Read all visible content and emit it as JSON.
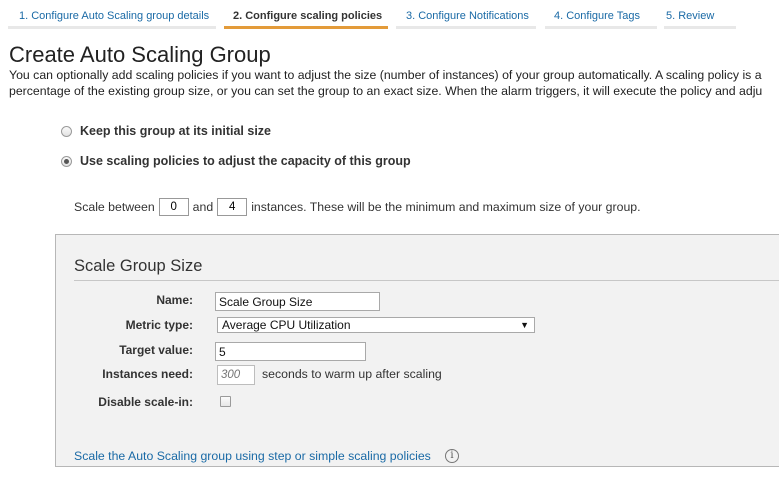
{
  "wizard": {
    "steps": [
      {
        "label": "1. Configure Auto Scaling group details"
      },
      {
        "label": "2. Configure scaling policies",
        "active": true
      },
      {
        "label": "3. Configure Notifications"
      },
      {
        "label": "4. Configure Tags"
      },
      {
        "label": "5. Review"
      }
    ],
    "active_color": "#e39b3a",
    "link_color": "#1a6aa6"
  },
  "page": {
    "title": "Create Auto Scaling Group",
    "intro_line1": "You can optionally add scaling policies if you want to adjust the size (number of instances) of your group automatically. A scaling policy is a",
    "intro_line2": "percentage of the existing group size, or you can set the group to an exact size. When the alarm triggers, it will execute the policy and adju"
  },
  "options": {
    "keep_size_label": "Keep this group at its initial size",
    "use_policies_label": "Use scaling policies to adjust the capacity of this group",
    "selected": "use_policies"
  },
  "scale_range": {
    "prefix": "Scale between",
    "min": "0",
    "and": "and",
    "max": "4",
    "suffix": "instances. These will be the minimum and maximum size of your group."
  },
  "policy": {
    "section_title": "Scale Group Size",
    "name_label": "Name:",
    "name_value": "Scale Group Size",
    "metric_label": "Metric type:",
    "metric_value": "Average CPU Utilization",
    "target_label": "Target value:",
    "target_value": "5",
    "warmup_label": "Instances need:",
    "warmup_placeholder": "300",
    "warmup_suffix": "seconds to warm up after scaling",
    "disable_label": "Disable scale-in:",
    "disable_checked": false,
    "step_link": "Scale the Auto Scaling group using step or simple scaling policies",
    "info_icon": "info-icon"
  }
}
